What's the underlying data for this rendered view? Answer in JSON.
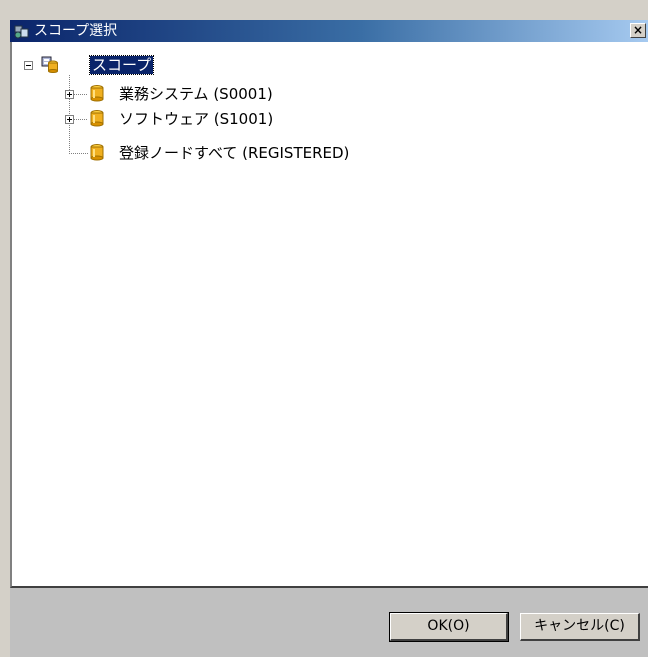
{
  "window": {
    "title": "スコープ選択",
    "close_label": "×"
  },
  "tree": {
    "root": {
      "label": "スコープ",
      "expanded": true,
      "selected": true
    },
    "children": [
      {
        "label": "業務システム (S0001)",
        "expandable": true
      },
      {
        "label": "ソフトウェア (S1001)",
        "expandable": true
      },
      {
        "label": "登録ノードすべて (REGISTERED)",
        "expandable": false
      }
    ]
  },
  "buttons": {
    "ok": "OK(O)",
    "cancel": "キャンセル(C)"
  },
  "colors": {
    "title_start": "#0a246a",
    "title_end": "#a6caf0",
    "selection": "#0a246a",
    "folder": "#f0b020"
  }
}
